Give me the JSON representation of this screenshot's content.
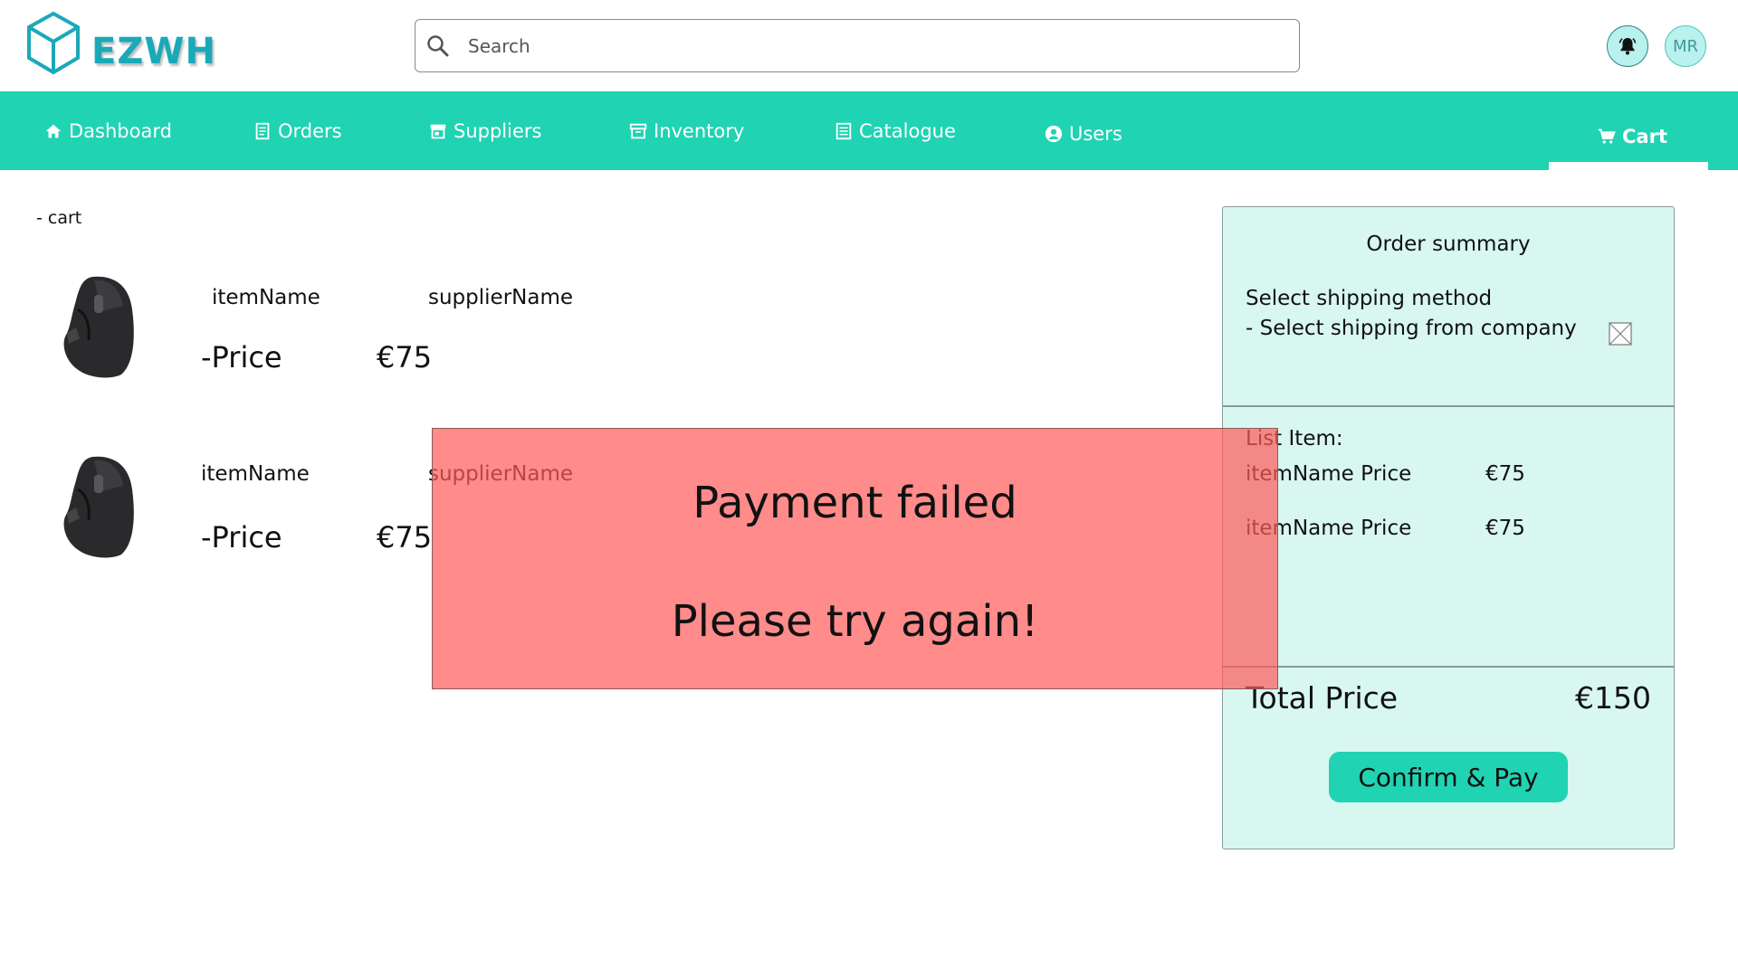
{
  "header": {
    "logo_text": "EZWH",
    "search_placeholder": "Search",
    "avatar_initials": "MR"
  },
  "nav": {
    "items": [
      {
        "label": "Dashboard",
        "icon": "home-icon"
      },
      {
        "label": "Orders",
        "icon": "receipt-icon"
      },
      {
        "label": "Suppliers",
        "icon": "store-icon"
      },
      {
        "label": "Inventory",
        "icon": "archive-icon"
      },
      {
        "label": "Catalogue",
        "icon": "list-icon"
      },
      {
        "label": "Users",
        "icon": "user-circle-icon"
      },
      {
        "label": "Cart",
        "icon": "cart-icon"
      }
    ],
    "active": "Cart"
  },
  "breadcrumb": "- cart",
  "cart_items": [
    {
      "name": "itemName",
      "supplier": "supplierName",
      "price_label": "-Price",
      "price": "€75"
    },
    {
      "name": "itemName",
      "supplier": "supplierName",
      "price_label": "-Price",
      "price": "€75"
    }
  ],
  "summary": {
    "title": "Order summary",
    "shipping_label": "Select shipping method",
    "shipping_company": "- Select shipping from company",
    "list_title": "List Item:",
    "list": [
      {
        "name": "itemName Price",
        "price": "€75"
      },
      {
        "name": "itemName Price",
        "price": "€75"
      }
    ],
    "total_label": "Total Price",
    "total_value": "€150",
    "pay_button": "Confirm & Pay"
  },
  "error": {
    "line1": "Payment failed",
    "line2": "Please try again!"
  },
  "colors": {
    "accent": "#20d3b3",
    "logo": "#1aa9b8",
    "summary_bg": "#d8f7f0",
    "error_bg": "#ff5a5a"
  }
}
